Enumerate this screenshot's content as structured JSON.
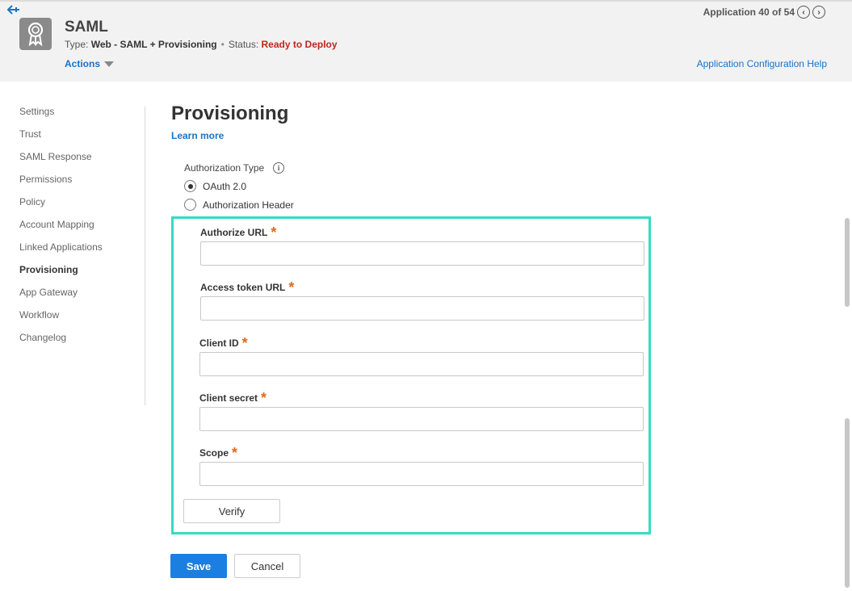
{
  "header": {
    "back_icon": "back-arrow-icon",
    "app_icon": "certificate-ribbon-icon",
    "title": "SAML",
    "type_label": "Type:",
    "type_value": "Web - SAML + Provisioning",
    "status_label": "Status:",
    "status_value": "Ready to Deploy",
    "status_color": "#c0261d",
    "actions_label": "Actions",
    "pager_text": "Application 40 of 54",
    "help_link": "Application Configuration Help"
  },
  "sidebar": {
    "items": [
      {
        "label": "Settings"
      },
      {
        "label": "Trust"
      },
      {
        "label": "SAML Response"
      },
      {
        "label": "Permissions"
      },
      {
        "label": "Policy"
      },
      {
        "label": "Account Mapping"
      },
      {
        "label": "Linked Applications"
      },
      {
        "label": "Provisioning",
        "active": true
      },
      {
        "label": "App Gateway"
      },
      {
        "label": "Workflow"
      },
      {
        "label": "Changelog"
      }
    ]
  },
  "main": {
    "title": "Provisioning",
    "learn_more": "Learn more",
    "auth_type_label": "Authorization Type",
    "auth_options": [
      {
        "label": "OAuth 2.0",
        "selected": true
      },
      {
        "label": "Authorization Header",
        "selected": false
      }
    ],
    "fields": [
      {
        "label": "Authorize URL",
        "required": "*",
        "value": ""
      },
      {
        "label": "Access token URL",
        "required": "*",
        "value": ""
      },
      {
        "label": "Client ID",
        "required": "*",
        "value": ""
      },
      {
        "label": "Client secret",
        "required": "*",
        "value": ""
      },
      {
        "label": "Scope",
        "required": "*",
        "value": ""
      }
    ],
    "verify_label": "Verify",
    "save_label": "Save",
    "cancel_label": "Cancel",
    "highlight_color": "#35dcc2",
    "accent_color": "#1a7fe0"
  }
}
